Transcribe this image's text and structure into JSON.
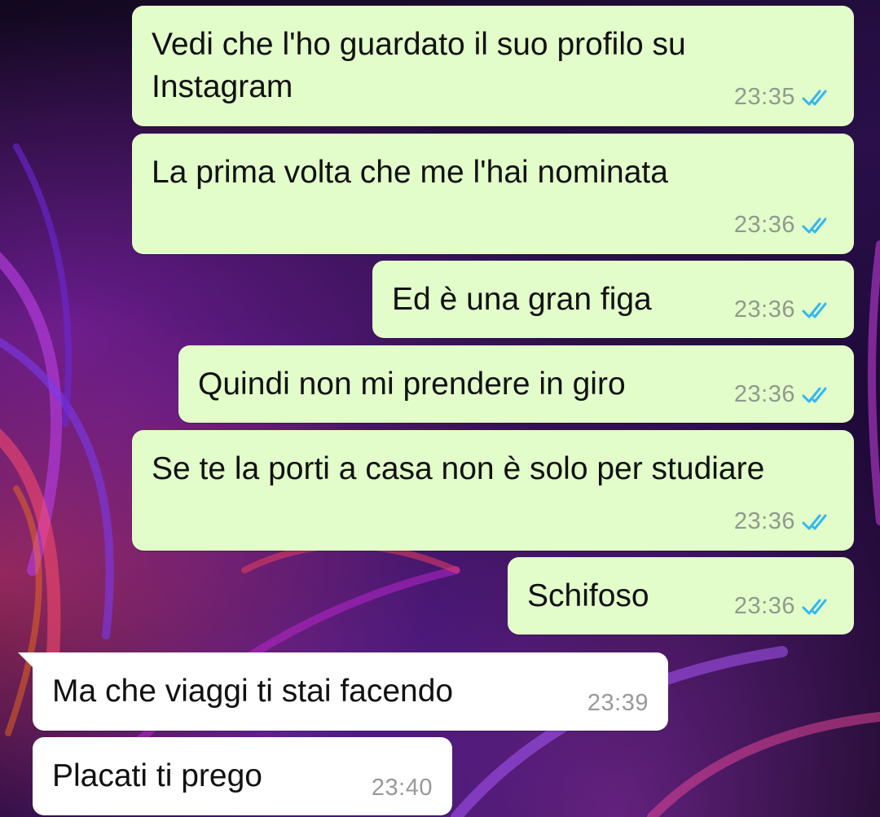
{
  "colors": {
    "outgoing_bubble": "#e2fdc9",
    "incoming_bubble": "#ffffff",
    "read_ticks": "#34b7f1"
  },
  "messages": [
    {
      "text": "Vedi che l'ho guardato il suo profilo su Instagram",
      "time": "23:35",
      "direction": "out",
      "status": "read"
    },
    {
      "text": "La prima volta che me l'hai nominata",
      "time": "23:36",
      "direction": "out",
      "status": "read"
    },
    {
      "text": "Ed è una gran figa",
      "time": "23:36",
      "direction": "out",
      "status": "read"
    },
    {
      "text": "Quindi non mi prendere in giro",
      "time": "23:36",
      "direction": "out",
      "status": "read"
    },
    {
      "text": "Se te la porti a casa non è solo per studiare",
      "time": "23:36",
      "direction": "out",
      "status": "read"
    },
    {
      "text": "Schifoso",
      "time": "23:36",
      "direction": "out",
      "status": "read"
    },
    {
      "text": "Ma che viaggi ti stai facendo",
      "time": "23:39",
      "direction": "in"
    },
    {
      "text": "Placati ti prego",
      "time": "23:40",
      "direction": "in"
    }
  ],
  "icons": {
    "read_receipt": "double-check-icon"
  }
}
